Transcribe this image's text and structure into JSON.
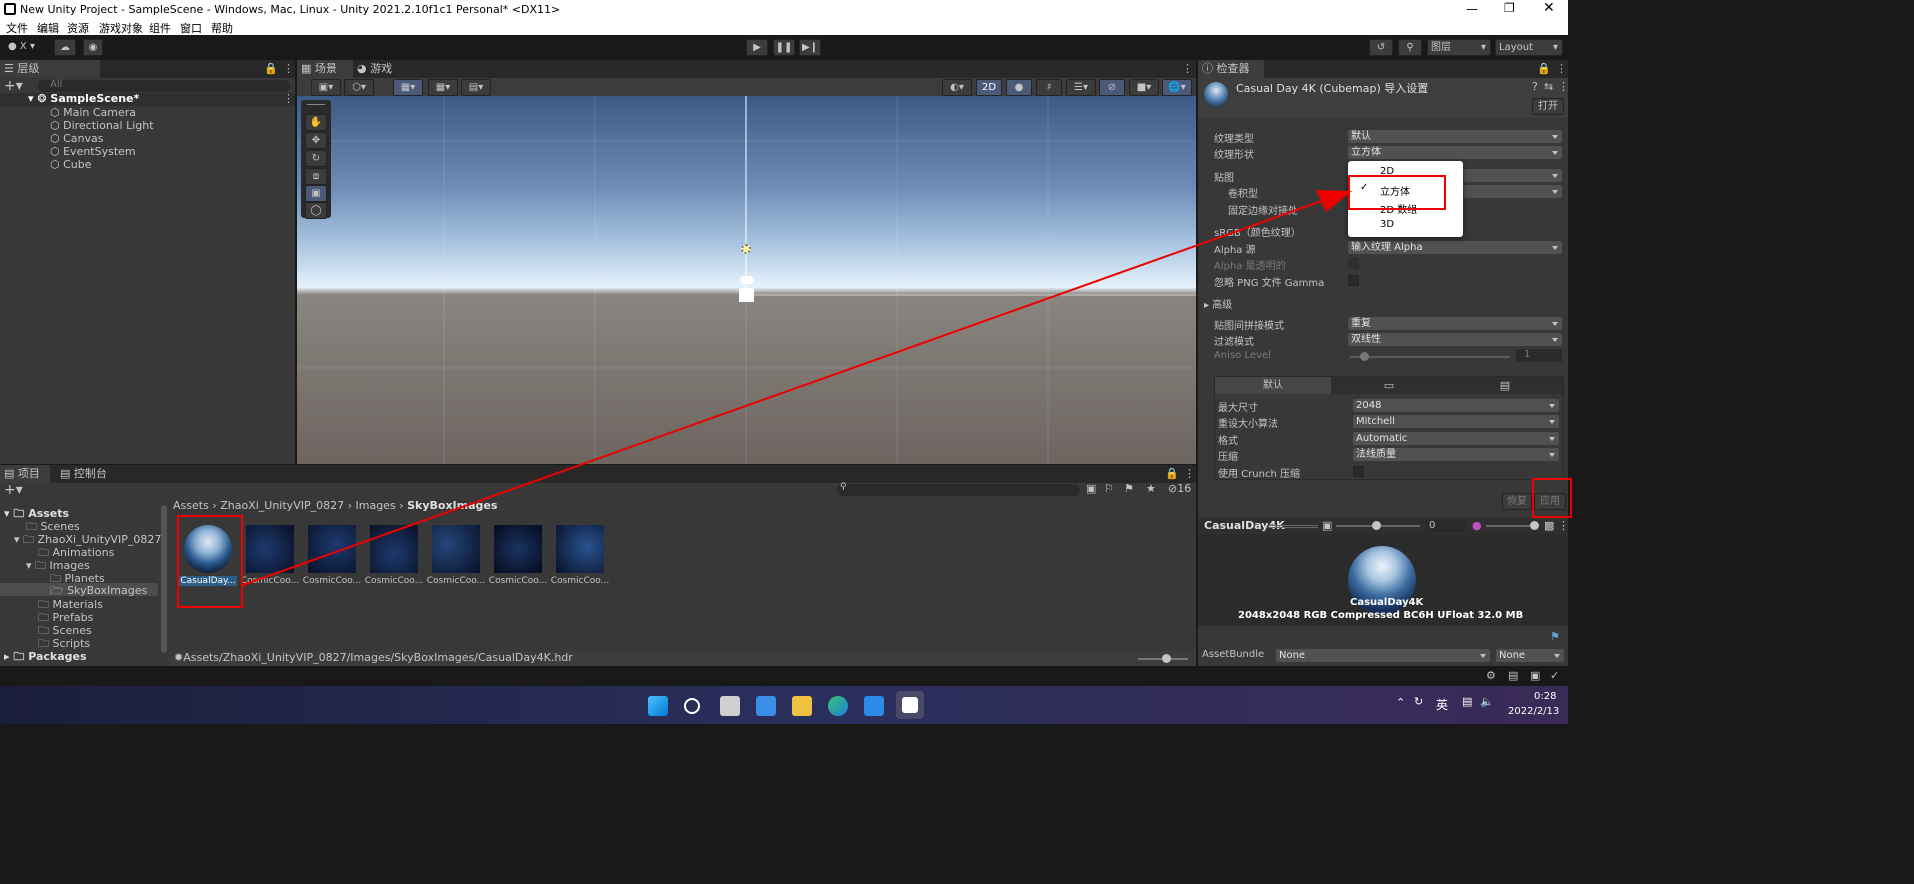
{
  "window": {
    "title": "New Unity Project - SampleScene - Windows, Mac, Linux - Unity 2021.2.10f1c1 Personal* <DX11>"
  },
  "menu": [
    "文件",
    "编辑",
    "资源",
    "游戏对象",
    "组件",
    "窗口",
    "帮助"
  ],
  "toolbar": {
    "account": "X",
    "layers": "图层",
    "layout": "Layout"
  },
  "hierarchy": {
    "tab": "层级",
    "search_placeholder": "All",
    "scene": "SampleScene*",
    "items": [
      "Main Camera",
      "Directional Light",
      "Canvas",
      "EventSystem",
      "Cube"
    ]
  },
  "scene_view": {
    "tabs": [
      "场景",
      "游戏"
    ],
    "mode_2d": "2D"
  },
  "project": {
    "tabs": [
      "项目",
      "控制台"
    ],
    "tree": [
      {
        "label": "Assets",
        "level": 0
      },
      {
        "label": "Scenes",
        "level": 1
      },
      {
        "label": "ZhaoXi_UnityVIP_0827",
        "level": 1
      },
      {
        "label": "Animations",
        "level": 2
      },
      {
        "label": "Images",
        "level": 2
      },
      {
        "label": "Planets",
        "level": 3
      },
      {
        "label": "SkyBoxImages",
        "level": 3
      },
      {
        "label": "Materials",
        "level": 2
      },
      {
        "label": "Prefabs",
        "level": 2
      },
      {
        "label": "Scenes",
        "level": 2
      },
      {
        "label": "Scripts",
        "level": 2
      },
      {
        "label": "Packages",
        "level": 0
      }
    ],
    "breadcrumb": [
      "Assets",
      "ZhaoXi_UnityVIP_0827",
      "Images",
      "SkyBoxImages"
    ],
    "hidden_count": "16",
    "assets": [
      "CasualDay...",
      "CosmicCoo...",
      "CosmicCoo...",
      "CosmicCoo...",
      "CosmicCoo...",
      "CosmicCoo...",
      "CosmicCoo..."
    ],
    "path": "Assets/ZhaoXi_UnityVIP_0827/Images/SkyBoxImages/CasualDay4K.hdr"
  },
  "inspector": {
    "tab": "检查器",
    "title": "Casual Day 4K (Cubemap) 导入设置",
    "open_button": "打开",
    "fields": [
      {
        "label": "纹理类型",
        "value": "默认"
      },
      {
        "label": "纹理形状",
        "value": "立方体"
      }
    ],
    "mapping_label": "贴图",
    "convolution_label": "卷积型",
    "fixed_edge_label": "固定边缘对接处",
    "srgb_label": "sRGB（颜色纹理）",
    "alpha_source_label": "Alpha 源",
    "alpha_source_value": "输入纹理 Alpha",
    "alpha_transparent_label": "Alpha 是透明的",
    "ignore_gamma_label": "忽略 PNG 文件 Gamma",
    "advanced_label": "高级",
    "wrap_label": "贴图间拼接模式",
    "wrap_value": "重复",
    "filter_label": "过滤模式",
    "filter_value": "双线性",
    "aniso_label": "Aniso Level",
    "aniso_value": "1",
    "platform_tab": "默认",
    "max_size_label": "最大尺寸",
    "max_size_value": "2048",
    "resize_label": "重设大小算法",
    "resize_value": "Mitchell",
    "format_label": "格式",
    "format_value": "Automatic",
    "compression_label": "压缩",
    "compression_value": "法线质量",
    "crunch_label": "使用 Crunch 压缩",
    "revert_button": "恢复",
    "apply_button": "应用",
    "shape_dropdown": [
      {
        "label": "2D",
        "checked": false
      },
      {
        "label": "立方体",
        "checked": true
      },
      {
        "label": "2D 数组",
        "checked": false
      },
      {
        "label": "3D",
        "checked": false
      }
    ],
    "preview": {
      "title": "CasualDay4K",
      "mip_value": "0",
      "name": "CasualDay4K",
      "info": "2048x2048  RGB Compressed BC6H UFloat   32.0 MB"
    },
    "assetbundle_label": "AssetBundle",
    "assetbundle_value": "None",
    "assetbundle_variant": "None"
  },
  "taskbar": {
    "ime": "英",
    "time": "0:28",
    "date": "2022/2/13"
  }
}
